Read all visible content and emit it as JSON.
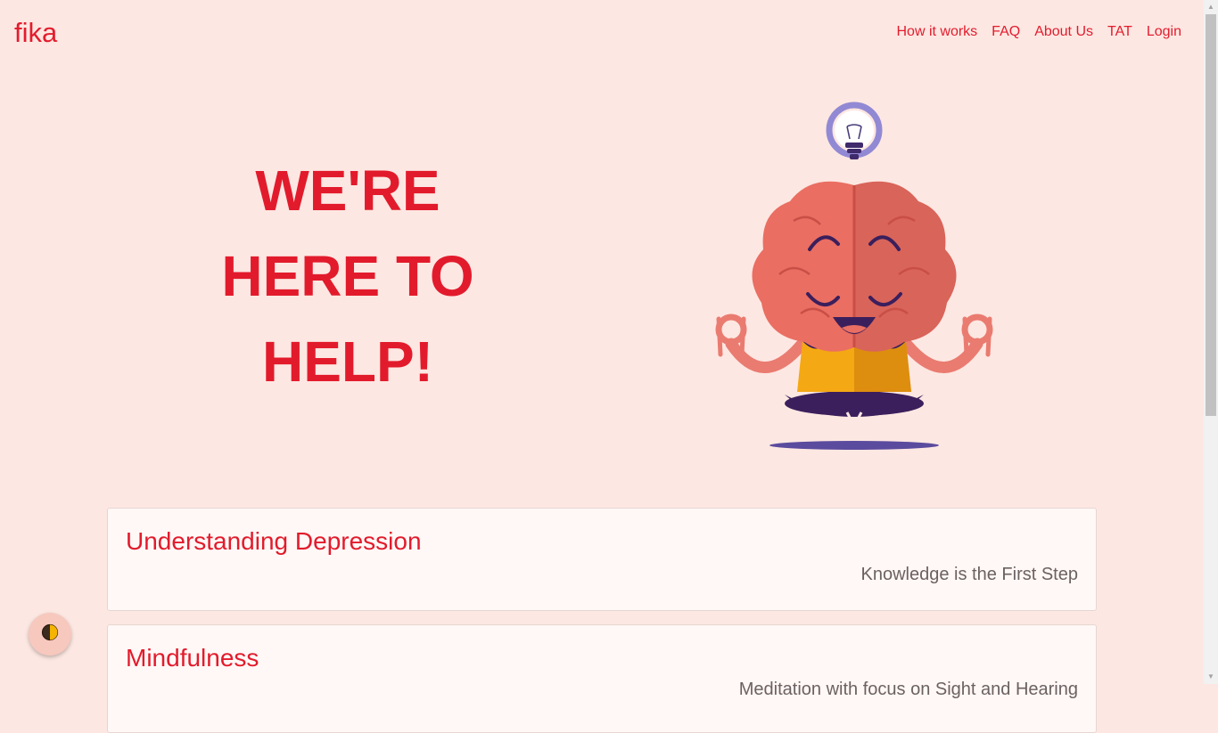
{
  "nav": {
    "brand": "fika",
    "links": [
      "How it works",
      "FAQ",
      "About Us",
      "TAT",
      "Login"
    ]
  },
  "hero": {
    "lines": [
      "WE'RE",
      "HERE TO",
      "HELP!"
    ],
    "illustration": "meditating-brain-with-lightbulb"
  },
  "cards": [
    {
      "title": "Understanding Depression",
      "subtitle": "Knowledge is the First Step"
    },
    {
      "title": "Mindfulness",
      "subtitle": "Meditation with focus on Sight and Hearing"
    }
  ],
  "theme_toggle": {
    "icon": "half-moon-icon"
  },
  "colors": {
    "background": "#fde7e2",
    "accent": "#e21b2c",
    "card_bg": "#fff8f6",
    "muted_text": "#6c6161"
  }
}
